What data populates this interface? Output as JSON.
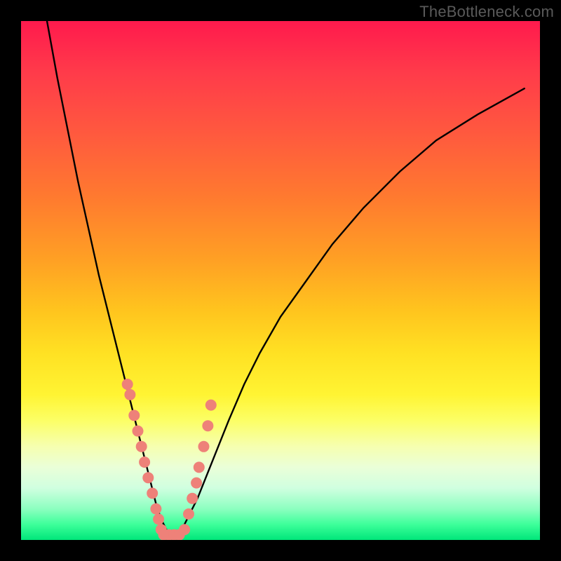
{
  "watermark": "TheBottleneck.com",
  "colors": {
    "curve": "#000000",
    "marker_fill": "#ee8179",
    "marker_stroke": "#ee8179",
    "frame": "#000000"
  },
  "chart_data": {
    "type": "line",
    "title": "",
    "xlabel": "",
    "ylabel": "",
    "xlim": [
      0,
      100
    ],
    "ylim": [
      0,
      100
    ],
    "series": [
      {
        "name": "bottleneck-curve",
        "x": [
          5,
          7,
          9,
          11,
          13,
          15,
          17,
          19,
          21,
          23,
          24,
          25,
          26,
          27,
          28,
          29,
          30,
          31,
          32,
          34,
          36,
          38,
          40,
          43,
          46,
          50,
          55,
          60,
          66,
          73,
          80,
          88,
          97
        ],
        "y": [
          100,
          89,
          79,
          69,
          60,
          51,
          43,
          35,
          27,
          19,
          15,
          11,
          7,
          4,
          2,
          1,
          1,
          2,
          4,
          8,
          13,
          18,
          23,
          30,
          36,
          43,
          50,
          57,
          64,
          71,
          77,
          82,
          87
        ]
      }
    ],
    "markers": {
      "name": "sample-points",
      "x": [
        20.5,
        21.0,
        21.8,
        22.5,
        23.2,
        23.8,
        24.5,
        25.3,
        26.0,
        26.5,
        27.0,
        27.5,
        28.5,
        29.5,
        30.5,
        31.5,
        32.3,
        33.0,
        33.8,
        34.3,
        35.2,
        36.0,
        36.6
      ],
      "y": [
        30,
        28,
        24,
        21,
        18,
        15,
        12,
        9,
        6,
        4,
        2,
        1,
        1,
        1,
        1,
        2,
        5,
        8,
        11,
        14,
        18,
        22,
        26
      ]
    }
  }
}
